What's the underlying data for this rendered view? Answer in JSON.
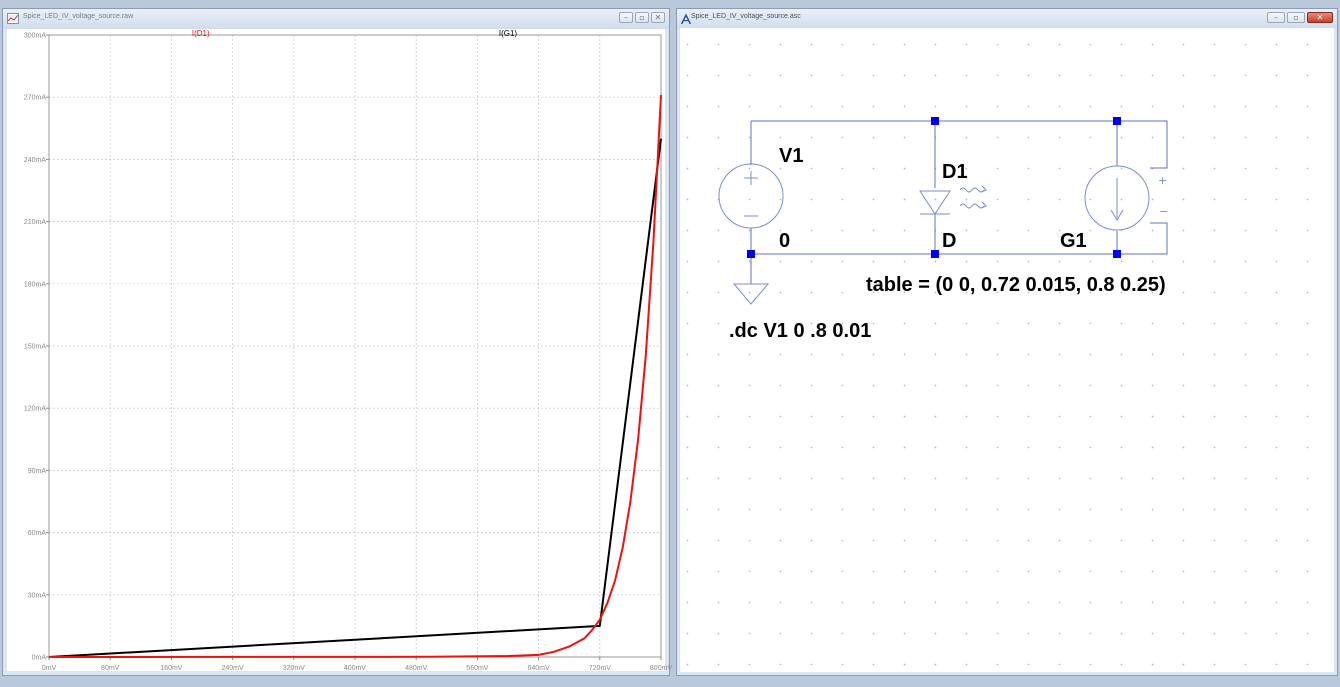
{
  "left_window": {
    "title": "Spice_LED_IV_voltage_source.raw",
    "controls": [
      "–",
      "▫",
      "✕"
    ]
  },
  "right_window": {
    "title": "Spice_LED_IV_voltage_source.asc",
    "controls": [
      "–",
      "▫",
      "✕"
    ]
  },
  "plot": {
    "trace_labels": [
      {
        "label": "I(D1)",
        "color": "#ee1111"
      },
      {
        "label": "I(G1)",
        "color": "#000000"
      }
    ]
  },
  "chart_data": {
    "type": "line",
    "title": "",
    "xlabel": "",
    "ylabel": "",
    "xlim": [
      0,
      0.8
    ],
    "ylim": [
      0,
      0.3
    ],
    "x_ticks": [
      "0mV",
      "80mV",
      "160mV",
      "240mV",
      "320mV",
      "400mV",
      "480mV",
      "560mV",
      "640mV",
      "720mV",
      "800mV"
    ],
    "y_ticks": [
      "0mA",
      "30mA",
      "60mA",
      "90mA",
      "120mA",
      "150mA",
      "180mA",
      "210mA",
      "240mA",
      "270mA",
      "300mA"
    ],
    "grid": true,
    "series": [
      {
        "name": "I(D1)",
        "color": "#ee1111",
        "x": [
          0,
          0.5,
          0.6,
          0.64,
          0.66,
          0.68,
          0.7,
          0.71,
          0.72,
          0.73,
          0.74,
          0.75,
          0.76,
          0.77,
          0.78,
          0.79,
          0.8
        ],
        "y": [
          0,
          0.0001,
          0.0005,
          0.001,
          0.0025,
          0.005,
          0.009,
          0.013,
          0.018,
          0.026,
          0.037,
          0.053,
          0.075,
          0.105,
          0.145,
          0.2,
          0.271
        ]
      },
      {
        "name": "I(G1)",
        "color": "#000000",
        "x": [
          0,
          0.72,
          0.8
        ],
        "y": [
          0,
          0.015,
          0.25
        ]
      }
    ]
  },
  "schematic": {
    "source_label": "V1",
    "diode_label": "D1",
    "diode_model": "D",
    "ground_node": "0",
    "bsource_label": "G1",
    "table_text": "table = (0 0, 0.72 0.015, 0.8 0.25)",
    "directive": ".dc V1 0 .8 0.01",
    "plus_sign": "+",
    "minus_sign": "−",
    "colors": {
      "wire": "#5f6fc8",
      "junction": "#0000ee",
      "component": "#7d8bd6",
      "text": "#000000"
    }
  }
}
